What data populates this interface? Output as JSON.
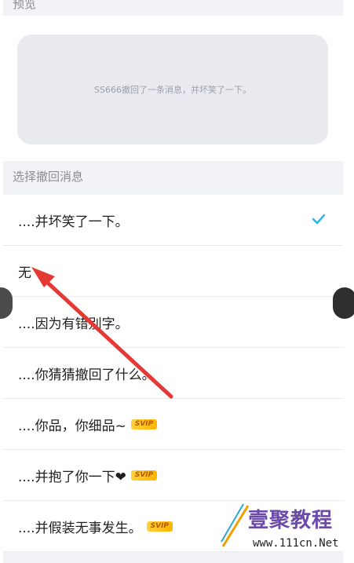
{
  "preview": {
    "section_label": "预览",
    "message": "SS666撤回了一条消息，并坏笑了一下。"
  },
  "select": {
    "section_label": "选择撤回消息",
    "options": [
      {
        "label": "....并坏笑了一下。",
        "selected": true,
        "svip": false
      },
      {
        "label": "无",
        "selected": false,
        "svip": false
      },
      {
        "label": "....因为有错别字。",
        "selected": false,
        "svip": false
      },
      {
        "label": "....你猜猜撤回了什么。",
        "selected": false,
        "svip": false
      },
      {
        "label": "....你品，你细品~",
        "selected": false,
        "svip": true
      },
      {
        "label": "....并抱了你一下❤",
        "selected": false,
        "svip": true
      },
      {
        "label": "....并假装无事发生。",
        "selected": false,
        "svip": true
      }
    ],
    "svip_badge": "SVIP"
  },
  "watermark": {
    "brand": "壹聚教程",
    "url": "www.111cn.Net"
  },
  "colors": {
    "accent_check": "#2bb8e8",
    "arrow": "#e53935",
    "svip_gold": "#ffc21a"
  },
  "icons": {
    "selected_indicator": "check-icon",
    "annotation": "arrow-icon"
  }
}
